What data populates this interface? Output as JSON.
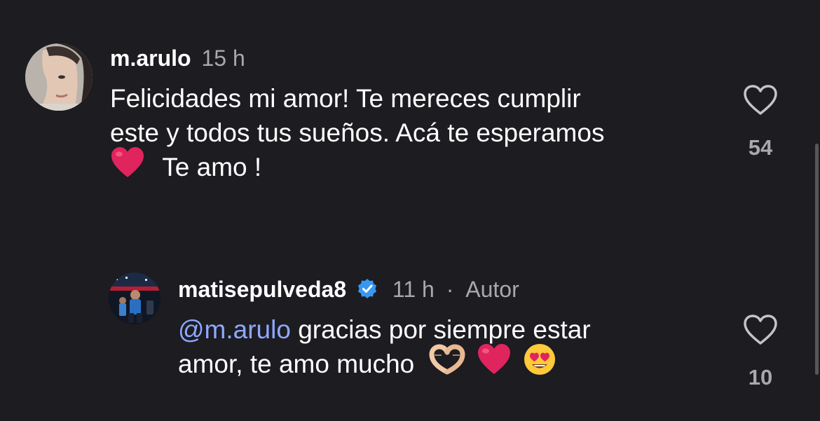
{
  "comments": [
    {
      "username": "m.arulo",
      "time": "15 h",
      "text_lines": [
        "Felicidades mi amor! Te mereces cumplir",
        "este y todos tus sueños. Acá te esperamos",
        "Te amo !"
      ],
      "emojis": [
        "heart-emoji"
      ],
      "likes": "54",
      "avatar_icon": "avatar-woman-profile"
    },
    {
      "username": "matisepulveda8",
      "verified_icon": "verified-badge-icon",
      "time": "11 h",
      "separator": "·",
      "author_label": "Autor",
      "mention": "@m.arulo",
      "text_line1_rest": " gracias por siempre estar",
      "text_line2": "amor, te amo mucho",
      "emojis": [
        "heart-hands-emoji",
        "heart-emoji",
        "heart-eyes-emoji"
      ],
      "likes": "10",
      "avatar_icon": "avatar-stadium-photo"
    }
  ],
  "colors": {
    "background": "#1c1c21",
    "text": "#ffffff",
    "muted": "#a8a8ad",
    "mention": "#8fa8ff",
    "verified": "#3897f0",
    "heart": "#e0245e"
  }
}
